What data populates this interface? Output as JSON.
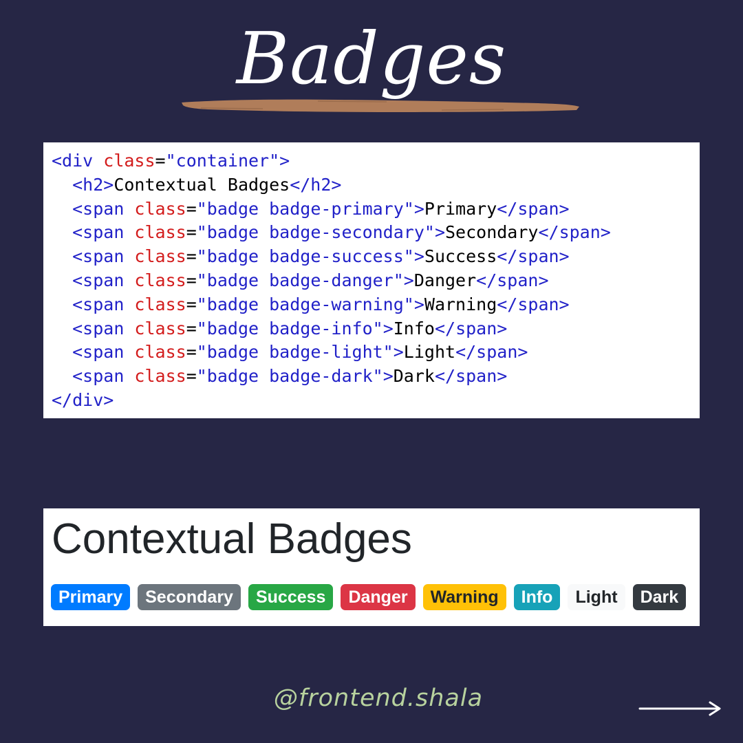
{
  "title": "Badges",
  "code": {
    "lines": [
      [
        [
          "tag",
          "<div "
        ],
        [
          "attr",
          "class"
        ],
        [
          "txt",
          "="
        ],
        [
          "val",
          "\"container\""
        ],
        [
          "tag",
          ">"
        ]
      ],
      [
        [
          "txt",
          "  "
        ],
        [
          "tag",
          "<h2>"
        ],
        [
          "txt",
          "Contextual Badges"
        ],
        [
          "tag",
          "</h2>"
        ]
      ],
      [
        [
          "txt",
          "  "
        ],
        [
          "tag",
          "<span "
        ],
        [
          "attr",
          "class"
        ],
        [
          "txt",
          "="
        ],
        [
          "val",
          "\"badge badge-primary\""
        ],
        [
          "tag",
          ">"
        ],
        [
          "txt",
          "Primary"
        ],
        [
          "tag",
          "</span>"
        ]
      ],
      [
        [
          "txt",
          "  "
        ],
        [
          "tag",
          "<span "
        ],
        [
          "attr",
          "class"
        ],
        [
          "txt",
          "="
        ],
        [
          "val",
          "\"badge badge-secondary\""
        ],
        [
          "tag",
          ">"
        ],
        [
          "txt",
          "Secondary"
        ],
        [
          "tag",
          "</span>"
        ]
      ],
      [
        [
          "txt",
          "  "
        ],
        [
          "tag",
          "<span "
        ],
        [
          "attr",
          "class"
        ],
        [
          "txt",
          "="
        ],
        [
          "val",
          "\"badge badge-success\""
        ],
        [
          "tag",
          ">"
        ],
        [
          "txt",
          "Success"
        ],
        [
          "tag",
          "</span>"
        ]
      ],
      [
        [
          "txt",
          "  "
        ],
        [
          "tag",
          "<span "
        ],
        [
          "attr",
          "class"
        ],
        [
          "txt",
          "="
        ],
        [
          "val",
          "\"badge badge-danger\""
        ],
        [
          "tag",
          ">"
        ],
        [
          "txt",
          "Danger"
        ],
        [
          "tag",
          "</span>"
        ]
      ],
      [
        [
          "txt",
          "  "
        ],
        [
          "tag",
          "<span "
        ],
        [
          "attr",
          "class"
        ],
        [
          "txt",
          "="
        ],
        [
          "val",
          "\"badge badge-warning\""
        ],
        [
          "tag",
          ">"
        ],
        [
          "txt",
          "Warning"
        ],
        [
          "tag",
          "</span>"
        ]
      ],
      [
        [
          "txt",
          "  "
        ],
        [
          "tag",
          "<span "
        ],
        [
          "attr",
          "class"
        ],
        [
          "txt",
          "="
        ],
        [
          "val",
          "\"badge badge-info\""
        ],
        [
          "tag",
          ">"
        ],
        [
          "txt",
          "Info"
        ],
        [
          "tag",
          "</span>"
        ]
      ],
      [
        [
          "txt",
          "  "
        ],
        [
          "tag",
          "<span "
        ],
        [
          "attr",
          "class"
        ],
        [
          "txt",
          "="
        ],
        [
          "val",
          "\"badge badge-light\""
        ],
        [
          "tag",
          ">"
        ],
        [
          "txt",
          "Light"
        ],
        [
          "tag",
          "</span>"
        ]
      ],
      [
        [
          "txt",
          "  "
        ],
        [
          "tag",
          "<span "
        ],
        [
          "attr",
          "class"
        ],
        [
          "txt",
          "="
        ],
        [
          "val",
          "\"badge badge-dark\""
        ],
        [
          "tag",
          ">"
        ],
        [
          "txt",
          "Dark"
        ],
        [
          "tag",
          "</span>"
        ]
      ],
      [
        [
          "tag",
          "</div>"
        ]
      ]
    ]
  },
  "preview": {
    "heading": "Contextual Badges",
    "badges": [
      {
        "label": "Primary",
        "bg": "#007bff",
        "fg": "#ffffff"
      },
      {
        "label": "Secondary",
        "bg": "#6c757d",
        "fg": "#ffffff"
      },
      {
        "label": "Success",
        "bg": "#28a745",
        "fg": "#ffffff"
      },
      {
        "label": "Danger",
        "bg": "#dc3545",
        "fg": "#ffffff"
      },
      {
        "label": "Warning",
        "bg": "#ffc107",
        "fg": "#212529"
      },
      {
        "label": "Info",
        "bg": "#17a2b8",
        "fg": "#ffffff"
      },
      {
        "label": "Light",
        "bg": "#f8f9fa",
        "fg": "#212529"
      },
      {
        "label": "Dark",
        "bg": "#343a40",
        "fg": "#ffffff"
      }
    ]
  },
  "footer": {
    "handle": "@frontend.shala",
    "arrow_icon": "arrow-right-icon"
  },
  "colors": {
    "background": "#262645",
    "brush": "#b07d5a",
    "handle": "#b8d29e"
  }
}
